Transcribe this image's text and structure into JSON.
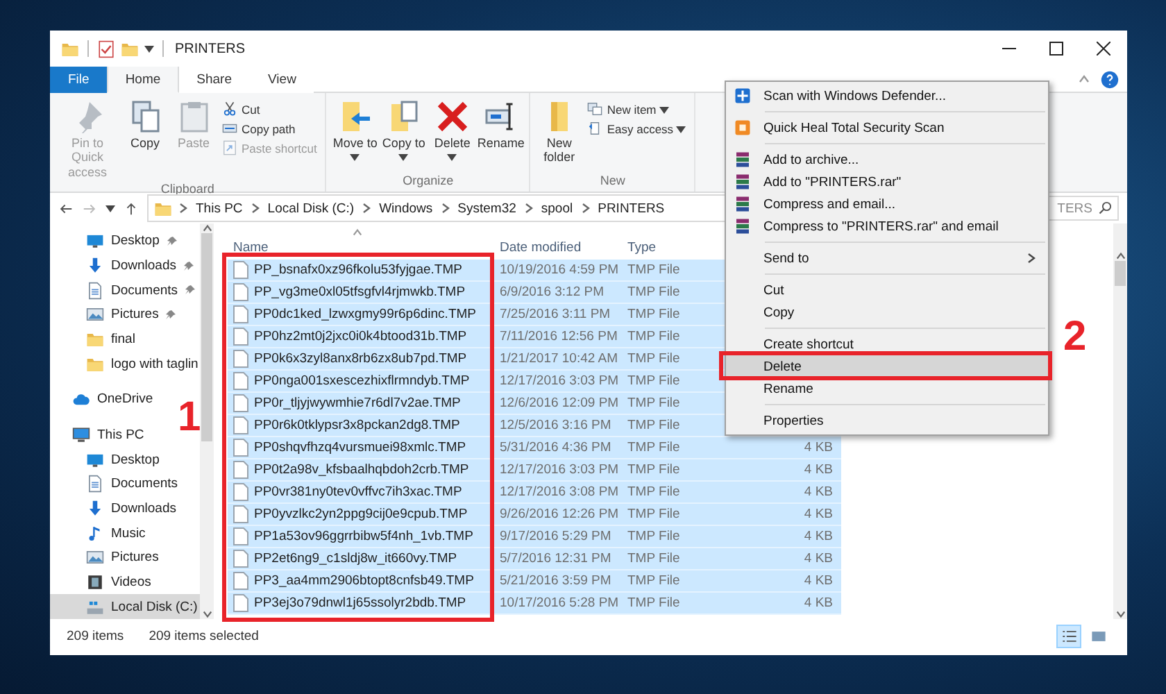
{
  "window": {
    "title": "PRINTERS"
  },
  "ribbon_tabs": [
    {
      "label": "File",
      "kind": "file",
      "selected": false
    },
    {
      "label": "Home",
      "kind": "tab",
      "selected": true
    },
    {
      "label": "Share",
      "kind": "tab",
      "selected": false
    },
    {
      "label": "View",
      "kind": "tab",
      "selected": false
    }
  ],
  "ribbon_groups": [
    {
      "label": "Clipboard",
      "large_commands": [
        {
          "label": "Pin to Quick access",
          "kind": "pin",
          "disabled": true,
          "dropdown": false
        },
        {
          "label": "Copy",
          "kind": "copy",
          "disabled": false,
          "dropdown": false
        },
        {
          "label": "Paste",
          "kind": "paste",
          "disabled": true,
          "dropdown": false
        }
      ],
      "small_commands": [
        {
          "label": "Cut",
          "kind": "cut",
          "disabled": false,
          "dropdown": false
        },
        {
          "label": "Copy path",
          "kind": "copypath",
          "disabled": false,
          "dropdown": false
        },
        {
          "label": "Paste shortcut",
          "kind": "pasteshortcut",
          "disabled": true,
          "dropdown": false
        }
      ]
    },
    {
      "label": "Organize",
      "large_commands": [
        {
          "label": "Move to",
          "kind": "moveto",
          "disabled": false,
          "dropdown": true
        },
        {
          "label": "Copy to",
          "kind": "copyto",
          "disabled": false,
          "dropdown": true
        },
        {
          "label": "Delete",
          "kind": "delete",
          "disabled": false,
          "dropdown": true
        },
        {
          "label": "Rename",
          "kind": "rename",
          "disabled": false,
          "dropdown": false
        }
      ]
    },
    {
      "label": "New",
      "large_commands": [
        {
          "label": "New folder",
          "kind": "newfolder",
          "disabled": false,
          "dropdown": false
        }
      ],
      "small_commands": [
        {
          "label": "New item",
          "kind": "newitem",
          "disabled": false,
          "dropdown": true
        },
        {
          "label": "Easy access",
          "kind": "easyaccess",
          "disabled": false,
          "dropdown": true
        }
      ]
    }
  ],
  "address_bar": {
    "path": [
      "This PC",
      "Local Disk (C:)",
      "Windows",
      "System32",
      "spool",
      "PRINTERS"
    ]
  },
  "search": {
    "placeholder": "TERS"
  },
  "sidebar": {
    "quick_access": [
      {
        "label": "Desktop",
        "kind": "desktop",
        "pinned": true,
        "selected": false
      },
      {
        "label": "Downloads",
        "kind": "download",
        "pinned": true,
        "selected": false
      },
      {
        "label": "Documents",
        "kind": "documents",
        "pinned": true,
        "selected": false
      },
      {
        "label": "Pictures",
        "kind": "pictures",
        "pinned": true,
        "selected": false
      },
      {
        "label": "final",
        "kind": "folder",
        "pinned": false,
        "selected": false
      },
      {
        "label": "logo with taglin",
        "kind": "folder",
        "pinned": false,
        "selected": false
      }
    ],
    "onedrive": {
      "label": "OneDrive",
      "selected": false
    },
    "this_pc": {
      "label": "This PC",
      "selected": false,
      "children": [
        {
          "label": "Desktop",
          "kind": "desktop",
          "selected": false
        },
        {
          "label": "Documents",
          "kind": "documents",
          "selected": false
        },
        {
          "label": "Downloads",
          "kind": "download",
          "selected": false
        },
        {
          "label": "Music",
          "kind": "music",
          "selected": false
        },
        {
          "label": "Pictures",
          "kind": "pictures",
          "selected": false
        },
        {
          "label": "Videos",
          "kind": "videos",
          "selected": false
        },
        {
          "label": "Local Disk (C:)",
          "kind": "disk",
          "selected": true
        }
      ]
    }
  },
  "file_list": {
    "columns": [
      "Name",
      "Date modified",
      "Type"
    ],
    "rows": [
      {
        "name": "PP_bsnafx0xz96fkolu53fyjgae.TMP",
        "date_modified": "10/19/2016 4:59 PM",
        "type": "TMP File",
        "selected": true
      },
      {
        "name": "PP_vg3me0xl05tfsgfvl4rjmwkb.TMP",
        "date_modified": "6/9/2016 3:12 PM",
        "type": "TMP File",
        "selected": true
      },
      {
        "name": "PP0dc1ked_lzwxgmy99r6p6dinc.TMP",
        "date_modified": "7/25/2016 3:11 PM",
        "type": "TMP File",
        "selected": true
      },
      {
        "name": "PP0hz2mt0j2jxc0i0k4btood31b.TMP",
        "date_modified": "7/11/2016 12:56 PM",
        "type": "TMP File",
        "selected": true
      },
      {
        "name": "PP0k6x3zyl8anx8rb6zx8ub7pd.TMP",
        "date_modified": "1/21/2017 10:42 AM",
        "type": "TMP File",
        "selected": true
      },
      {
        "name": "PP0nga001sxescezhixflrmndyb.TMP",
        "date_modified": "12/17/2016 3:03 PM",
        "type": "TMP File",
        "selected": true
      },
      {
        "name": "PP0r_tljyjwywmhie7r6dl7v2ae.TMP",
        "date_modified": "12/6/2016 12:09 PM",
        "type": "TMP File",
        "selected": true
      },
      {
        "name": "PP0r6k0tklypsr3x8pckan2dg8.TMP",
        "date_modified": "12/5/2016 3:16 PM",
        "type": "TMP File",
        "selected": true
      },
      {
        "name": "PP0shqvfhzq4vursmuei98xmlc.TMP",
        "date_modified": "5/31/2016 4:36 PM",
        "type": "TMP File",
        "size": "4 KB",
        "selected": true
      },
      {
        "name": "PP0t2a98v_kfsbaalhqbdoh2crb.TMP",
        "date_modified": "12/17/2016 3:03 PM",
        "type": "TMP File",
        "size": "4 KB",
        "selected": true
      },
      {
        "name": "PP0vr381ny0tev0vffvc7ih3xac.TMP",
        "date_modified": "12/17/2016 3:08 PM",
        "type": "TMP File",
        "size": "4 KB",
        "selected": true
      },
      {
        "name": "PP0yvzlkc2yn2ppg9cij0e9cpub.TMP",
        "date_modified": "9/26/2016 12:26 PM",
        "type": "TMP File",
        "size": "4 KB",
        "selected": true
      },
      {
        "name": "PP1a53ov96ggrrbibw5f4nh_1vb.TMP",
        "date_modified": "9/17/2016 5:29 PM",
        "type": "TMP File",
        "size": "4 KB",
        "selected": true
      },
      {
        "name": "PP2et6ng9_c1sldj8w_it660vy.TMP",
        "date_modified": "5/7/2016 12:31 PM",
        "type": "TMP File",
        "size": "4 KB",
        "selected": true
      },
      {
        "name": "PP3_aa4mm2906btopt8cnfsb49.TMP",
        "date_modified": "5/21/2016 3:59 PM",
        "type": "TMP File",
        "size": "4 KB",
        "selected": true
      },
      {
        "name": "PP3ej3o79dnwl1j65ssolyr2bdb.TMP",
        "date_modified": "10/17/2016 5:28 PM",
        "type": "TMP File",
        "size": "4 KB",
        "selected": true
      }
    ]
  },
  "context_menu": {
    "items": [
      {
        "kind": "defender",
        "label": "Scan with Windows Defender...",
        "highlighted": false
      },
      {
        "kind": "separator"
      },
      {
        "kind": "quickheal",
        "label": "Quick Heal Total Security Scan",
        "highlighted": false
      },
      {
        "kind": "separator"
      },
      {
        "kind": "archive",
        "label": "Add to archive...",
        "highlighted": false
      },
      {
        "kind": "archive",
        "label": "Add to \"PRINTERS.rar\"",
        "highlighted": false
      },
      {
        "kind": "archive",
        "label": "Compress and email...",
        "highlighted": false
      },
      {
        "kind": "archive",
        "label": "Compress to \"PRINTERS.rar\" and email",
        "highlighted": false
      },
      {
        "kind": "separator"
      },
      {
        "kind": "submenu",
        "label": "Send to",
        "highlighted": false
      },
      {
        "kind": "separator"
      },
      {
        "kind": "plain",
        "label": "Cut",
        "highlighted": false
      },
      {
        "kind": "plain",
        "label": "Copy",
        "highlighted": false
      },
      {
        "kind": "separator"
      },
      {
        "kind": "plain",
        "label": "Create shortcut",
        "highlighted": false
      },
      {
        "kind": "plain",
        "label": "Delete",
        "highlighted": true
      },
      {
        "kind": "plain",
        "label": "Rename",
        "highlighted": false
      },
      {
        "kind": "separator"
      },
      {
        "kind": "plain",
        "label": "Properties",
        "highlighted": false
      }
    ]
  },
  "status_bar": {
    "item_count": "209 items",
    "selection": "209 items selected"
  },
  "view_buttons": [
    {
      "kind": "details",
      "selected": true
    },
    {
      "kind": "large_icons",
      "selected": false
    }
  ],
  "annotations": [
    {
      "label": "1"
    },
    {
      "label": "2"
    }
  ]
}
